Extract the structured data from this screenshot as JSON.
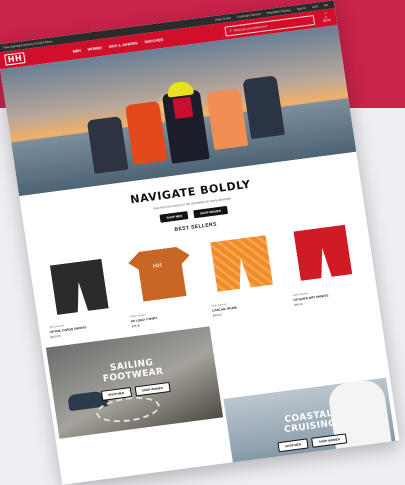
{
  "topbar": {
    "left_text": "Free Standard Delivery On All Orders",
    "links": [
      "Help Center",
      "Customer Service",
      "Newsletter Signup",
      "Sign In",
      "USD",
      "EN"
    ]
  },
  "header": {
    "logo": "HH",
    "nav": [
      "MEN",
      "WOMEN",
      "KIDS & JUNIORS",
      "DISCOVER"
    ],
    "search_placeholder": "What are you looking for?",
    "cart_count": "0",
    "cart_total": "$0.00"
  },
  "hero": {
    "headline": "NAVIGATE BOLDLY",
    "subtext": "Gear from the oceans to the mountains for every adventure",
    "shop_men": "SHOP MEN",
    "shop_women": "SHOP WOMEN"
  },
  "best_sellers": {
    "title": "BEST SELLERS",
    "products": [
      {
        "brand": "Helly Hansen",
        "name": "HP FOIL CARGO SHORTS",
        "price": "$100.00"
      },
      {
        "brand": "Helly Hansen",
        "name": "HH LOGO T-SHIRT",
        "price": "$35.00"
      },
      {
        "brand": "Helly Hansen",
        "name": "CASCAIS TRUNK",
        "price": "$55.00"
      },
      {
        "brand": "Helly Hansen",
        "name": "HP QUICK-DRY SHORTS",
        "price": "$90.00"
      }
    ]
  },
  "promos": [
    {
      "title_line1": "SAILING",
      "title_line2": "FOOTWEAR",
      "btn1": "SHOP MEN",
      "btn2": "SHOP WOMEN"
    },
    {
      "title_line1": "COASTAL",
      "title_line2": "CRUISING",
      "btn1": "SHOP MEN",
      "btn2": "SHOP WOMEN"
    }
  ],
  "colors": {
    "brand_red": "#d0102b",
    "backdrop_red": "#c8234a"
  }
}
